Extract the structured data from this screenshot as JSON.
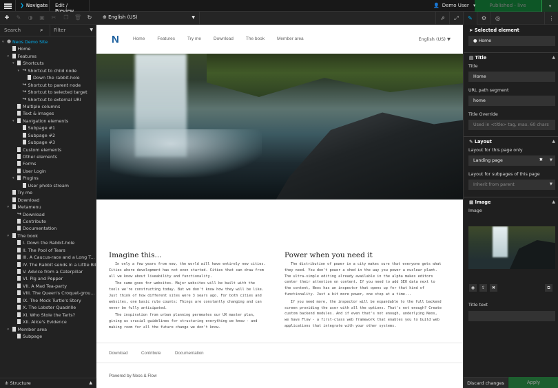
{
  "topbar": {
    "navigate": "Navigate",
    "mode": "Edit / Preview",
    "user": "Demo User",
    "publish": "Published - live"
  },
  "toolbar": {
    "dimension": "English (US)"
  },
  "left": {
    "search_placeholder": "Search",
    "filter_placeholder": "Filter",
    "structure": "Structure",
    "tree": [
      {
        "label": "Neos Demo Site",
        "depth": 0,
        "type": "site",
        "toggle": "▾"
      },
      {
        "label": "Home",
        "depth": 1,
        "type": "doc",
        "toggle": ""
      },
      {
        "label": "Features",
        "depth": 1,
        "type": "doc",
        "toggle": "▾"
      },
      {
        "label": "Shortcuts",
        "depth": 2,
        "type": "doc",
        "toggle": "▾"
      },
      {
        "label": "Shortcut to child node",
        "depth": 3,
        "type": "sc",
        "toggle": "▾"
      },
      {
        "label": "Down the rabbit-hole",
        "depth": 4,
        "type": "doc",
        "toggle": ""
      },
      {
        "label": "Shortcut to parent node",
        "depth": 3,
        "type": "sc",
        "toggle": ""
      },
      {
        "label": "Shortcut to selected target",
        "depth": 3,
        "type": "sc",
        "toggle": ""
      },
      {
        "label": "Shortcut to external URI",
        "depth": 3,
        "type": "sc",
        "toggle": ""
      },
      {
        "label": "Multiple columns",
        "depth": 2,
        "type": "doc",
        "toggle": ""
      },
      {
        "label": "Text & images",
        "depth": 2,
        "type": "doc",
        "toggle": ""
      },
      {
        "label": "Navigation elements",
        "depth": 2,
        "type": "doc",
        "toggle": "▾"
      },
      {
        "label": "Subpage #1",
        "depth": 3,
        "type": "doc",
        "toggle": ""
      },
      {
        "label": "Subpage #2",
        "depth": 3,
        "type": "doc",
        "toggle": ""
      },
      {
        "label": "Subpage #3",
        "depth": 3,
        "type": "doc",
        "toggle": ""
      },
      {
        "label": "Custom elements",
        "depth": 2,
        "type": "doc",
        "toggle": ""
      },
      {
        "label": "Other elements",
        "depth": 2,
        "type": "doc",
        "toggle": ""
      },
      {
        "label": "Forms",
        "depth": 2,
        "type": "doc",
        "toggle": ""
      },
      {
        "label": "User Login",
        "depth": 2,
        "type": "doc",
        "toggle": ""
      },
      {
        "label": "Plugins",
        "depth": 2,
        "type": "doc",
        "toggle": "▾"
      },
      {
        "label": "User photo stream",
        "depth": 3,
        "type": "doc",
        "toggle": ""
      },
      {
        "label": "Try me",
        "depth": 1,
        "type": "doc",
        "toggle": ""
      },
      {
        "label": "Download",
        "depth": 1,
        "type": "doc",
        "toggle": ""
      },
      {
        "label": "Metamenu",
        "depth": 1,
        "type": "doc",
        "toggle": "▾"
      },
      {
        "label": "Download",
        "depth": 2,
        "type": "sc",
        "toggle": ""
      },
      {
        "label": "Contribute",
        "depth": 2,
        "type": "doc",
        "toggle": ""
      },
      {
        "label": "Documentation",
        "depth": 2,
        "type": "doc",
        "toggle": ""
      },
      {
        "label": "The book",
        "depth": 1,
        "type": "doc",
        "toggle": "▾"
      },
      {
        "label": "I. Down the Rabbit-hole",
        "depth": 2,
        "type": "doc",
        "toggle": ""
      },
      {
        "label": "II. The Pool of Tears",
        "depth": 2,
        "type": "doc",
        "toggle": ""
      },
      {
        "label": "III. A Caucus-race and a Long T...",
        "depth": 2,
        "type": "doc",
        "toggle": ""
      },
      {
        "label": "IV. The Rabbit sends in a Little Bill",
        "depth": 2,
        "type": "doc",
        "toggle": ""
      },
      {
        "label": "V. Advice from a Caterpillar",
        "depth": 2,
        "type": "doc",
        "toggle": ""
      },
      {
        "label": "VI. Pig and Pepper",
        "depth": 2,
        "type": "doc",
        "toggle": ""
      },
      {
        "label": "VII. A Mad Tea-party",
        "depth": 2,
        "type": "doc",
        "toggle": ""
      },
      {
        "label": "VIII. The Queen's Croquet-grou...",
        "depth": 2,
        "type": "doc",
        "toggle": ""
      },
      {
        "label": "IX. The Mock Turtle's Story",
        "depth": 2,
        "type": "doc",
        "toggle": ""
      },
      {
        "label": "X. The Lobster Quadrille",
        "depth": 2,
        "type": "doc",
        "toggle": ""
      },
      {
        "label": "XI. Who Stole the Tarts?",
        "depth": 2,
        "type": "doc",
        "toggle": ""
      },
      {
        "label": "XII. Alice's Evidence",
        "depth": 2,
        "type": "doc",
        "toggle": ""
      },
      {
        "label": "Member area",
        "depth": 1,
        "type": "doc",
        "toggle": "▾"
      },
      {
        "label": "Subpage",
        "depth": 2,
        "type": "doc",
        "toggle": ""
      }
    ]
  },
  "site": {
    "logo": "N",
    "nav": [
      "Home",
      "Features",
      "Try me",
      "Download",
      "The book",
      "Member area"
    ],
    "lang": "English (US) ▼",
    "col1_title": "Imagine this...",
    "col1_p1": "In only a few years from now, the world will have entirely new cities. Cities where development has not even started. Cities that can draw from all we know about liveability and functionality.",
    "col1_p2": "The same goes for websites. Major websites will be built with the tools we're constructing today. But we don't know how they will be like. Just think of how different sites were 3 years ago. For both cities and websites, one basic rule counts: Things are constantly changing and can never be fully anticipated.",
    "col1_p3": "The inspiration from urban planning permeates our UX master plan, giving us crucial guidelines for structuring everything we know  - and making room for all the future change we don't know.",
    "col2_title": "Power when you need it",
    "col2_p1": "The distribution of power in a city makes sure that everyone gets what they need. You don't power a shed in the way you power a nuclear plant. The ultra-simple editing already available in the alpha makes editors center their attention on content. If you need to add SEO data next to the content, Neos has an inspector that opens up for that kind of functionality. Just a bit more power, one step at a time...",
    "col2_p2": "If you need more, the inspector will be expandable to the full backend screen providing the user with all the options. That's not enough? Create custom backend modules. And if even that's not enough, underlying Neos, we have Flow - a first-class web framework that enables you to build web applications that integrate with your other systems.",
    "footer": [
      "Download",
      "Contribute",
      "Documentation"
    ],
    "powered": "Powered by Neos & Flow"
  },
  "inspector": {
    "selected_title": "Selected element",
    "selected_value": "Home",
    "title_section": "Title",
    "title_label": "Title",
    "title_value": "Home",
    "url_label": "URL path segment",
    "url_value": "home",
    "override_label": "Title Override",
    "override_placeholder": "Used in <title> tag, max. 60 chars",
    "layout_section": "Layout",
    "layout_page_label": "Layout for this page only",
    "layout_page_value": "Landing page",
    "layout_sub_label": "Layout for subpages of this page",
    "layout_sub_value": "Inherit from parent",
    "image_section": "Image",
    "image_label": "Image",
    "title_text_label": "Title text",
    "discard": "Discard changes",
    "apply": "Apply"
  }
}
